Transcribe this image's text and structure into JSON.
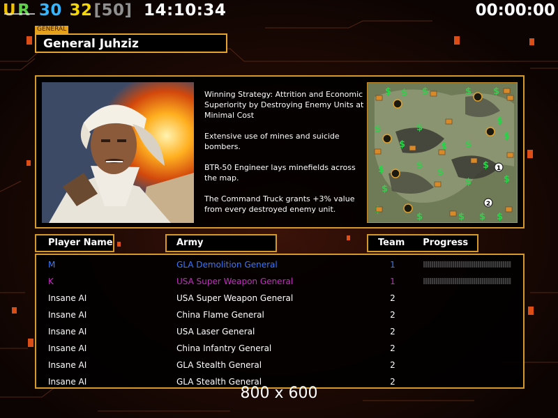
{
  "hud": {
    "stat_u": "U",
    "stat_r": "R",
    "stat_a": "30",
    "stat_b": "32",
    "stat_c": "[50]",
    "clock": "14:10:34",
    "timer": "00:00:00"
  },
  "general": {
    "tag": "GENERAL",
    "name": "General Juhziz",
    "description": [
      "Winning Strategy: Attrition and Economic Superiority by Destroying Enemy Units at Minimal Cost",
      "Extensive use of mines and suicide bombers.",
      "BTR-50 Engineer lays minefields across the map.",
      "The Command Truck grants +3% value from every destroyed enemy unit."
    ]
  },
  "minimap": {
    "start_labels": [
      "1",
      "2"
    ]
  },
  "headers": {
    "player": "Player Name",
    "army": "Army",
    "team": "Team",
    "progress": "Progress"
  },
  "players": [
    {
      "name": "M",
      "army": "GLA Demolition General",
      "team": "1",
      "color": "#3a78ff",
      "progress_bar": true
    },
    {
      "name": "K",
      "army": "USA Super Weapon General",
      "team": "1",
      "color": "#c22fc0",
      "progress_bar": true
    },
    {
      "name": "Insane AI",
      "army": "USA Super Weapon General",
      "team": "2",
      "color": "#ffffff",
      "progress_bar": false
    },
    {
      "name": "Insane AI",
      "army": "China Flame General",
      "team": "2",
      "color": "#ffffff",
      "progress_bar": false
    },
    {
      "name": "Insane AI",
      "army": "USA Laser General",
      "team": "2",
      "color": "#ffffff",
      "progress_bar": false
    },
    {
      "name": "Insane AI",
      "army": "China Infantry General",
      "team": "2",
      "color": "#ffffff",
      "progress_bar": false
    },
    {
      "name": "Insane AI",
      "army": "GLA Stealth General",
      "team": "2",
      "color": "#ffffff",
      "progress_bar": false
    },
    {
      "name": "Insane AI",
      "army": "GLA Stealth General",
      "team": "2",
      "color": "#ffffff",
      "progress_bar": false
    }
  ],
  "footer": "800 x 600",
  "colors": {
    "accent": "#d89a26",
    "background": "#150704",
    "team1_label": "#3a78ff"
  }
}
